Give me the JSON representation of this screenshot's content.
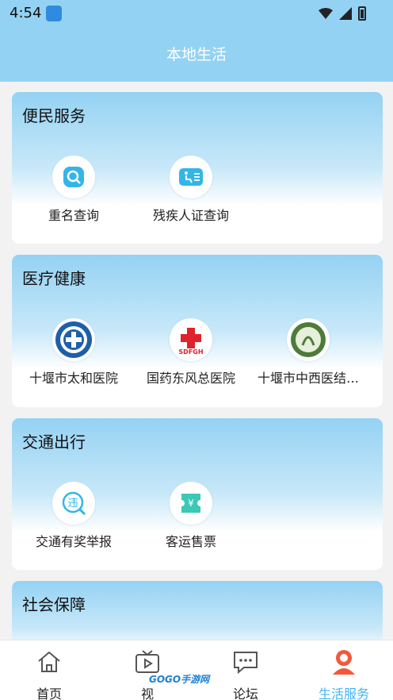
{
  "status_bar": {
    "time": "4:54"
  },
  "header": {
    "title": "本地生活"
  },
  "sections": [
    {
      "title": "便民服务",
      "items": [
        {
          "label": "重名查询",
          "icon": "name-search-icon"
        },
        {
          "label": "残疾人证查询",
          "icon": "disability-card-icon"
        }
      ]
    },
    {
      "title": "医疗健康",
      "items": [
        {
          "label": "十堰市太和医院",
          "icon": "taihe-hospital-logo"
        },
        {
          "label": "国药东风总医院",
          "icon": "sdfgh-logo"
        },
        {
          "label": "十堰市中西医结…",
          "icon": "integrated-hospital-logo"
        }
      ]
    },
    {
      "title": "交通出行",
      "items": [
        {
          "label": "交通有奖举报",
          "icon": "violation-report-icon"
        },
        {
          "label": "客运售票",
          "icon": "ticket-icon"
        }
      ]
    },
    {
      "title": "社会保障",
      "items": []
    }
  ],
  "sdfgh_text": "SDFGH",
  "violation_char": "违",
  "yen_char": "¥",
  "bottom_nav": [
    {
      "label": "首页",
      "icon": "home-icon"
    },
    {
      "label": "视",
      "icon": "video-icon"
    },
    {
      "label": "论坛",
      "icon": "forum-icon"
    },
    {
      "label": "生活服务",
      "icon": "life-service-icon",
      "active": true
    }
  ],
  "watermark": "GOGO手游网",
  "colors": {
    "header_bg": "#94d2f3",
    "accent": "#43b4f0",
    "active_icon": "#f05a3c"
  }
}
